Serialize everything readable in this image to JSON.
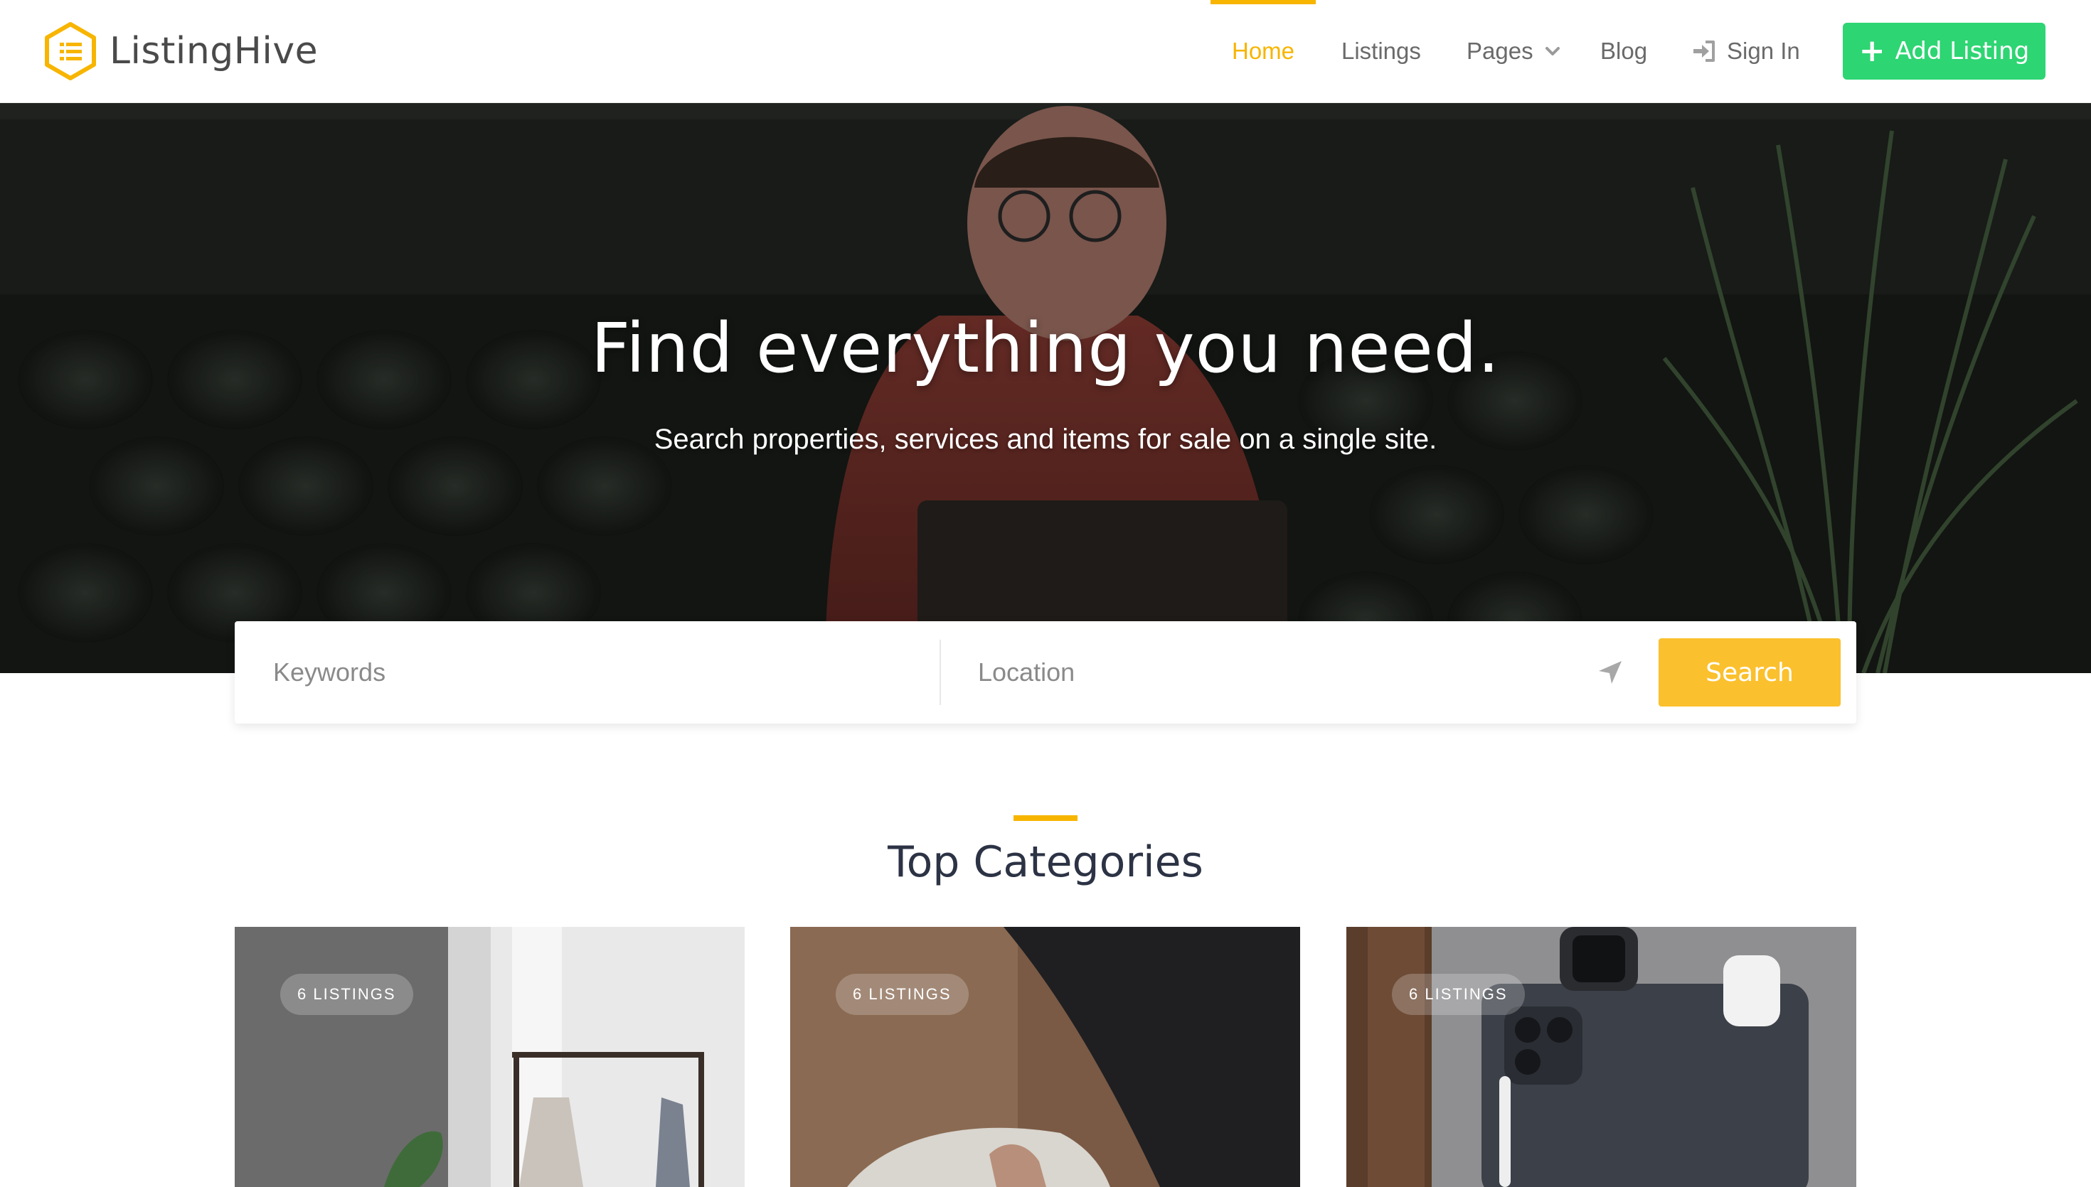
{
  "brand": {
    "name": "ListingHive",
    "accent_color": "#f7b500"
  },
  "nav": {
    "items": [
      {
        "label": "Home"
      },
      {
        "label": "Listings"
      },
      {
        "label": "Pages"
      },
      {
        "label": "Blog"
      },
      {
        "label": "Sign In"
      }
    ],
    "active": "Home",
    "add_listing": {
      "label": "Add Listing",
      "icon": "plus-icon",
      "color": "#2ed573"
    }
  },
  "hero": {
    "title": "Find everything you need.",
    "subtitle": "Search properties, services and items for sale on a single site."
  },
  "search": {
    "keywords_placeholder": "Keywords",
    "location_placeholder": "Location",
    "locate_icon": "location-arrow-icon",
    "button_label": "Search",
    "button_color": "#fbc02d"
  },
  "categories": {
    "title": "Top Categories",
    "cards": [
      {
        "badge": "6 LISTINGS"
      },
      {
        "badge": "6 LISTINGS"
      },
      {
        "badge": "6 LISTINGS"
      }
    ]
  }
}
